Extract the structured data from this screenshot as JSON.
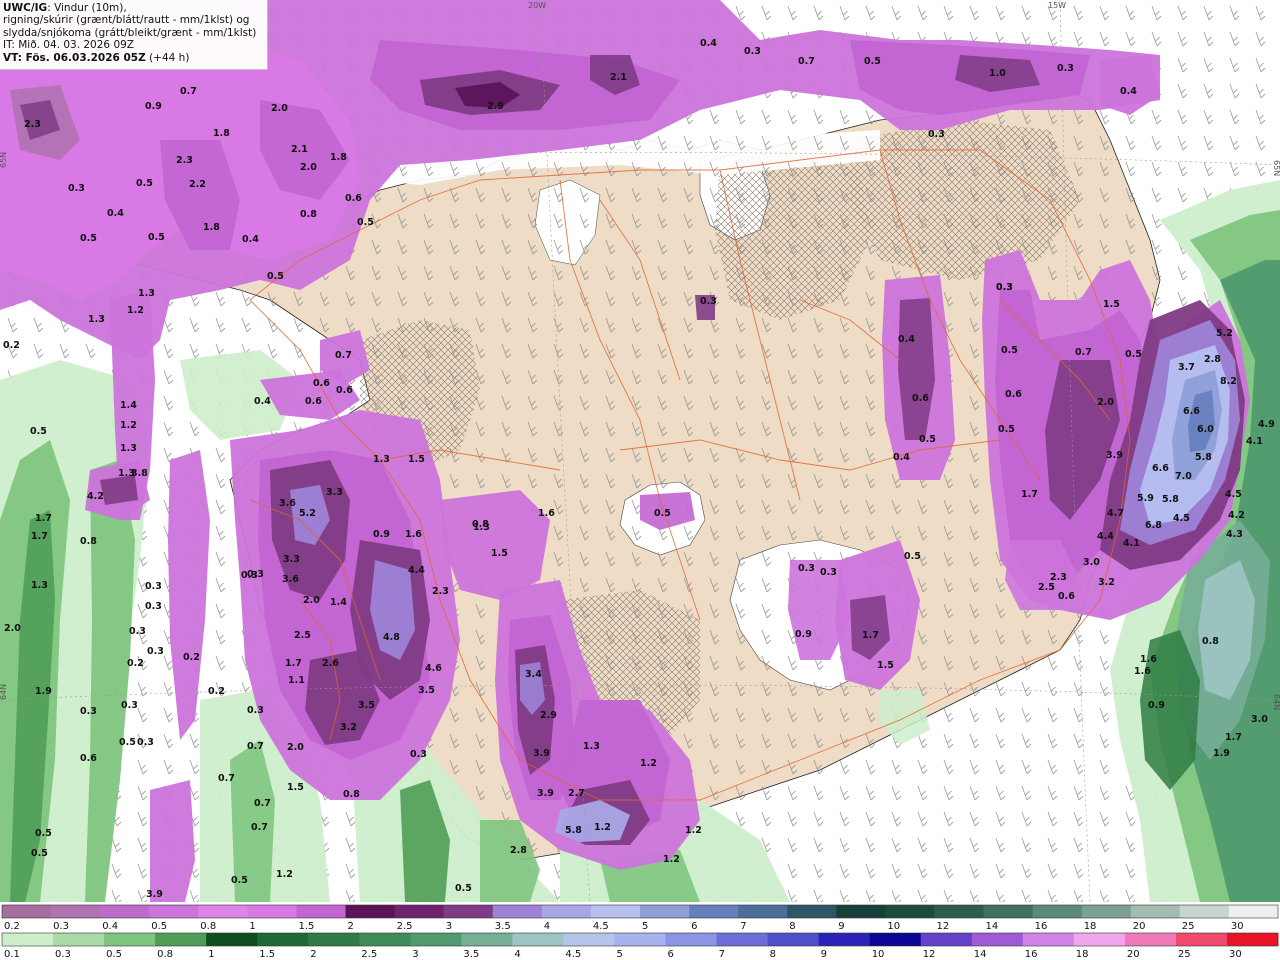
{
  "header": {
    "model": "UWC/IG",
    "line1_rest": ": Vindur (10m),",
    "line2": "rigning/skúrir (grænt/blátt/rautt - mm/1klst) og",
    "line3": "slydda/snjókoma (grátt/bleikt/grænt - mm/1klst)",
    "init_time": "IT: Mið. 04. 03. 2026 09Z",
    "valid_prefix": "VT: Fös. 06.03.2026 05Z",
    "lead": " (+44 h)"
  },
  "grid_labels": {
    "lon_top_1": "20W",
    "lon_top_2": "15W",
    "lat_left_1": "65N",
    "lat_left_2": "64N",
    "lat_right_1": "65N",
    "lat_right_2": "64N"
  },
  "colors": {
    "land": "#efdcc6",
    "road": "#e0652e",
    "coast": "#222222",
    "sea": "#ffffff"
  },
  "legend": {
    "snow": {
      "values": [
        "0.2",
        "0.3",
        "0.4",
        "0.5",
        "0.8",
        "1",
        "1.5",
        "2",
        "2.5",
        "3",
        "3.5",
        "4",
        "4.5",
        "5",
        "6",
        "7",
        "8",
        "9",
        "10",
        "12",
        "14",
        "16",
        "18",
        "20",
        "25",
        "30"
      ],
      "colors": [
        "#a56f9f",
        "#b072b0",
        "#bc6ccb",
        "#cc74db",
        "#dc84e6",
        "#d879e6",
        "#c265d3",
        "#5b1358",
        "#6e2270",
        "#7f3b85",
        "#9d82d6",
        "#a9a6e6",
        "#b6c0f0",
        "#8fa0d8",
        "#667fbc",
        "#4c6f9a",
        "#2e5664",
        "#173f3c",
        "#1b4c3d",
        "#2d5d4f",
        "#40705f",
        "#5b8a78",
        "#7ea090",
        "#a4bcb0",
        "#c9d6cf",
        "#eeeeee"
      ]
    },
    "rain": {
      "values": [
        "0.1",
        "0.3",
        "0.5",
        "0.8",
        "1",
        "1.5",
        "2",
        "2.5",
        "3",
        "3.5",
        "4",
        "4.5",
        "5",
        "6",
        "7",
        "8",
        "9",
        "10",
        "12",
        "14",
        "16",
        "18",
        "20",
        "25",
        "30"
      ],
      "colors": [
        "#cdeecb",
        "#a9dba6",
        "#7fc580",
        "#4f9d56",
        "#0d4e1a",
        "#1f6a33",
        "#2f7c44",
        "#3d8b58",
        "#4f9a6e",
        "#77ae96",
        "#9fc4c4",
        "#b5c4e8",
        "#a8b2ee",
        "#8c94e4",
        "#6d6ed8",
        "#4f4fcc",
        "#2b23b8",
        "#0a0595",
        "#6441c8",
        "#a05ad6",
        "#d084e6",
        "#f2a6ee",
        "#f07ab8",
        "#ee4a6e",
        "#e8142a"
      ]
    }
  },
  "map_values": {
    "top": [
      {
        "t": "2.3"
      },
      {
        "t": "0.9"
      },
      {
        "t": "0.7"
      },
      {
        "t": "2.9"
      },
      {
        "t": "2.1"
      },
      {
        "t": "0.4"
      },
      {
        "t": "0.3"
      },
      {
        "t": "0.7"
      },
      {
        "t": "0.5"
      },
      {
        "t": "1.0"
      },
      {
        "t": "0.3"
      },
      {
        "t": "0.4"
      },
      {
        "t": "0.3"
      },
      {
        "t": "2.0"
      },
      {
        "t": "1.8"
      },
      {
        "t": "2.1"
      },
      {
        "t": "2.0"
      },
      {
        "t": "1.8"
      },
      {
        "t": "2.3"
      },
      {
        "t": "2.2"
      },
      {
        "t": "0.3"
      },
      {
        "t": "0.5"
      },
      {
        "t": "0.4"
      },
      {
        "t": "1.8"
      },
      {
        "t": "0.5"
      },
      {
        "t": "0.5"
      },
      {
        "t": "0.8"
      },
      {
        "t": "0.6"
      },
      {
        "t": "0.5"
      },
      {
        "t": "0.4"
      },
      {
        "t": "0.5"
      },
      {
        "t": "1.3"
      },
      {
        "t": "1.2"
      },
      {
        "t": "1.3"
      }
    ],
    "west": [
      {
        "t": "0.2"
      },
      {
        "t": "0.7"
      },
      {
        "t": "0.6"
      },
      {
        "t": "0.6"
      },
      {
        "t": "0.4"
      },
      {
        "t": "0.6"
      },
      {
        "t": "0.5"
      },
      {
        "t": "1.4"
      },
      {
        "t": "1.2"
      },
      {
        "t": "1.3"
      },
      {
        "t": "1.3"
      },
      {
        "t": "3.8"
      },
      {
        "t": "4.2"
      },
      {
        "t": "1.7"
      },
      {
        "t": "0.8"
      },
      {
        "t": "1.7"
      },
      {
        "t": "1.3"
      },
      {
        "t": "2.0"
      },
      {
        "t": "1.9"
      },
      {
        "t": "3.6"
      },
      {
        "t": "3.3"
      },
      {
        "t": "5.2"
      },
      {
        "t": "3.3"
      },
      {
        "t": "3.6"
      },
      {
        "t": "0.3"
      },
      {
        "t": "2.0"
      },
      {
        "t": "1.4"
      },
      {
        "t": "2.5"
      },
      {
        "t": "1.7"
      },
      {
        "t": "2.6"
      },
      {
        "t": "1.1"
      },
      {
        "t": "3.5"
      },
      {
        "t": "3.2"
      },
      {
        "t": "2.0"
      },
      {
        "t": "1.5"
      },
      {
        "t": "0.7"
      },
      {
        "t": "0.3"
      },
      {
        "t": "0.3"
      },
      {
        "t": "0.3"
      },
      {
        "t": "0.3"
      },
      {
        "t": "0.3"
      },
      {
        "t": "0.2"
      },
      {
        "t": "0.2"
      },
      {
        "t": "0.2"
      },
      {
        "t": "0.3"
      },
      {
        "t": "0.5"
      },
      {
        "t": "0.3"
      },
      {
        "t": "0.3"
      },
      {
        "t": "0.5"
      },
      {
        "t": "0.5"
      },
      {
        "t": "0.7"
      },
      {
        "t": "1.2"
      },
      {
        "t": "0.5"
      },
      {
        "t": "3.9"
      },
      {
        "t": "0.6"
      },
      {
        "t": "0.7"
      },
      {
        "t": "0.7"
      },
      {
        "t": "0.3"
      },
      {
        "t": "0.8"
      },
      {
        "t": "1.3"
      },
      {
        "t": "1.6"
      },
      {
        "t": "0.9"
      },
      {
        "t": "4.4"
      },
      {
        "t": "2.3"
      },
      {
        "t": "4.8"
      },
      {
        "t": "4.6"
      },
      {
        "t": "3.5"
      },
      {
        "t": "1.5"
      },
      {
        "t": "1.6"
      },
      {
        "t": "1.5"
      },
      {
        "t": "1.3"
      },
      {
        "t": "0.3"
      },
      {
        "t": "0.8"
      }
    ],
    "south": [
      {
        "t": "3.4"
      },
      {
        "t": "2.9"
      },
      {
        "t": "3.9"
      },
      {
        "t": "1.3"
      },
      {
        "t": "1.2"
      },
      {
        "t": "3.9"
      },
      {
        "t": "2.7"
      },
      {
        "t": "5.8"
      },
      {
        "t": "1.2"
      },
      {
        "t": "1.2"
      },
      {
        "t": "1.2"
      },
      {
        "t": "2.8"
      },
      {
        "t": "0.5"
      },
      {
        "t": "0.3"
      }
    ],
    "interior": [
      {
        "t": "0.3"
      },
      {
        "t": "0.3"
      },
      {
        "t": "0.4"
      },
      {
        "t": "0.6"
      },
      {
        "t": "0.5"
      },
      {
        "t": "0.4"
      },
      {
        "t": "0.3"
      },
      {
        "t": "0.5"
      },
      {
        "t": "0.9"
      },
      {
        "t": "1.7"
      },
      {
        "t": "1.5"
      },
      {
        "t": "0.5"
      }
    ],
    "east": [
      {
        "t": "0.3"
      },
      {
        "t": "1.5"
      },
      {
        "t": "0.5"
      },
      {
        "t": "0.7"
      },
      {
        "t": "0.6"
      },
      {
        "t": "0.5"
      },
      {
        "t": "2.0"
      },
      {
        "t": "0.5"
      },
      {
        "t": "1.7"
      },
      {
        "t": "3.9"
      },
      {
        "t": "3.7"
      },
      {
        "t": "2.8"
      },
      {
        "t": "5.2"
      },
      {
        "t": "8.2"
      },
      {
        "t": "6.6"
      },
      {
        "t": "6.0"
      },
      {
        "t": "5.8"
      },
      {
        "t": "6.6"
      },
      {
        "t": "7.0"
      },
      {
        "t": "5.8"
      },
      {
        "t": "5.9"
      },
      {
        "t": "4.7"
      },
      {
        "t": "6.8"
      },
      {
        "t": "4.5"
      },
      {
        "t": "4.1"
      },
      {
        "t": "4.4"
      },
      {
        "t": "3.0"
      },
      {
        "t": "2.3"
      },
      {
        "t": "2.5"
      },
      {
        "t": "3.2"
      },
      {
        "t": "0.6"
      },
      {
        "t": "4.5"
      },
      {
        "t": "4.2"
      },
      {
        "t": "4.3"
      },
      {
        "t": "4.9"
      },
      {
        "t": "4.1"
      },
      {
        "t": "0.8"
      },
      {
        "t": "1.6"
      },
      {
        "t": "1.6"
      },
      {
        "t": "0.9"
      },
      {
        "t": "3.0"
      },
      {
        "t": "1.7"
      },
      {
        "t": "1.9"
      }
    ]
  }
}
